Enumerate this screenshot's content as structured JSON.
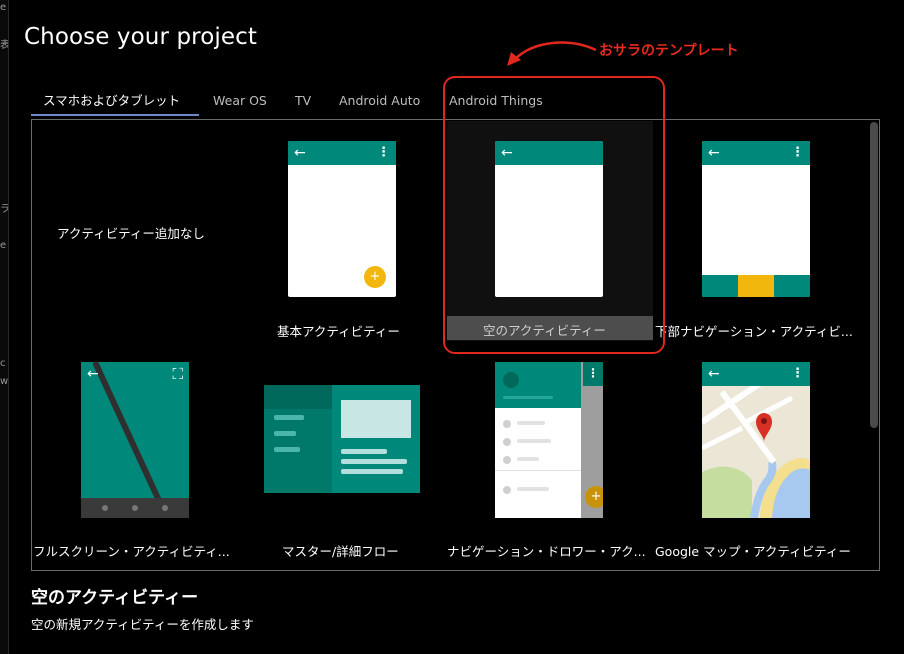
{
  "window": {
    "title": "Choose your project",
    "left_edge_chars": [
      "e",
      "表",
      "ラ",
      "e",
      "c",
      "w"
    ]
  },
  "tabs": [
    {
      "label": "スマホおよびタブレット",
      "active": true
    },
    {
      "label": "Wear OS",
      "active": false
    },
    {
      "label": "TV",
      "active": false
    },
    {
      "label": "Android Auto",
      "active": false
    },
    {
      "label": "Android Things",
      "active": false
    }
  ],
  "templates": [
    {
      "label": "アクティビティー追加なし",
      "preview": "none"
    },
    {
      "label": "基本アクティビティー",
      "preview": "basic"
    },
    {
      "label": "空のアクティビティー",
      "preview": "empty",
      "selected": true
    },
    {
      "label": "下部ナビゲーション・アクティビ...",
      "preview": "bottom-nav"
    },
    {
      "label": "フルスクリーン・アクティビティ...",
      "preview": "fullscreen"
    },
    {
      "label": "マスター/詳細フロー",
      "preview": "master-detail"
    },
    {
      "label": "ナビゲーション・ドロワー・アク...",
      "preview": "nav-drawer"
    },
    {
      "label": "Google マップ・アクティビティー",
      "preview": "maps"
    }
  ],
  "annotation": {
    "text": "おサラのテンプレート",
    "color": "#e0281c"
  },
  "selection_detail": {
    "title": "空のアクティビティー",
    "description": "空の新規アクティビティーを作成します"
  },
  "icons": {
    "back": "←",
    "more": "⋮",
    "add": "+",
    "fullscreen": "⛶"
  },
  "colors": {
    "teal": "#00897b",
    "accent": "#f2b70d",
    "tab_underline": "#6f86c9"
  }
}
